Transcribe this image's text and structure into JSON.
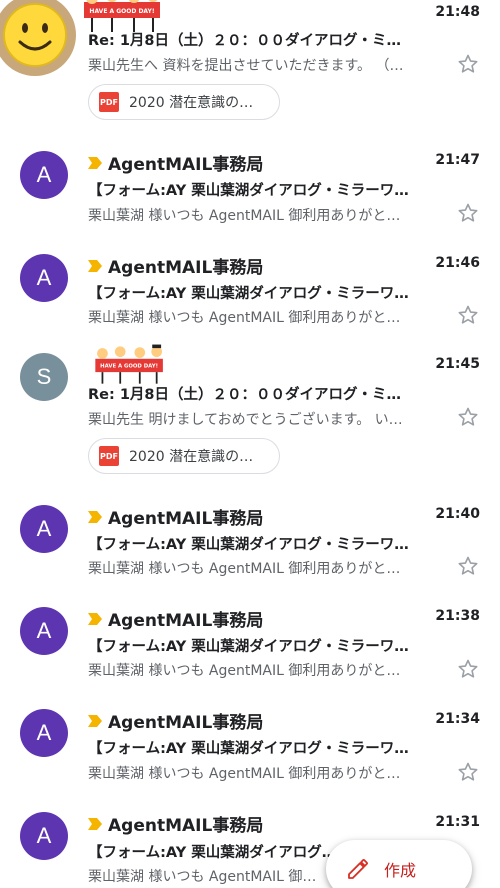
{
  "colors": {
    "accent_purple": "#5e35b1",
    "accent_gray": "#78909c",
    "important_yellow": "#f4b400",
    "compose_red": "#d93025"
  },
  "emails": [
    {
      "avatar_type": "smiley",
      "sender": "",
      "has_sticker": true,
      "sticker_text": "HAVE A GOOD DAY!",
      "time": "21:48",
      "subject": "Re: 1月8日（土）２０：００ダイアログ・ミ…",
      "snippet": "栗山先生へ 資料を提出させていただきます。 （…",
      "attachment": "2020 潜在意識の…"
    },
    {
      "avatar_type": "letter",
      "avatar_letter": "A",
      "important": true,
      "sender": "AgentMAIL事務局",
      "time": "21:47",
      "subject": "【フォーム:AY 栗山葉湖ダイアログ・ミラーワ…",
      "snippet": "栗山葉湖 様いつも AgentMAIL 御利用ありがと…"
    },
    {
      "avatar_type": "letter",
      "avatar_letter": "A",
      "important": true,
      "sender": "AgentMAIL事務局",
      "time": "21:46",
      "subject": "【フォーム:AY 栗山葉湖ダイアログ・ミラーワ…",
      "snippet": "栗山葉湖 様いつも AgentMAIL 御利用ありがと…"
    },
    {
      "avatar_type": "letter",
      "avatar_letter": "S",
      "sender": "",
      "has_sticker": true,
      "sticker_text": "HAVE A GOOD DAY!",
      "time": "21:45",
      "subject": "Re: 1月8日（土）２０：００ダイアログ・ミ…",
      "snippet": "栗山先生 明けましておめでとうございます。 い…",
      "attachment": "2020 潜在意識の…"
    },
    {
      "avatar_type": "letter",
      "avatar_letter": "A",
      "important": true,
      "sender": "AgentMAIL事務局",
      "time": "21:40",
      "subject": "【フォーム:AY 栗山葉湖ダイアログ・ミラーワ…",
      "snippet": "栗山葉湖 様いつも AgentMAIL 御利用ありがと…"
    },
    {
      "avatar_type": "letter",
      "avatar_letter": "A",
      "important": true,
      "sender": "AgentMAIL事務局",
      "time": "21:38",
      "subject": "【フォーム:AY 栗山葉湖ダイアログ・ミラーワ…",
      "snippet": "栗山葉湖 様いつも AgentMAIL 御利用ありがと…"
    },
    {
      "avatar_type": "letter",
      "avatar_letter": "A",
      "important": true,
      "sender": "AgentMAIL事務局",
      "time": "21:34",
      "subject": "【フォーム:AY 栗山葉湖ダイアログ・ミラーワ…",
      "snippet": "栗山葉湖 様いつも AgentMAIL 御利用ありがと…"
    },
    {
      "avatar_type": "letter",
      "avatar_letter": "A",
      "important": true,
      "sender": "AgentMAIL事務局",
      "time": "21:31",
      "subject": "【フォーム:AY 栗山葉湖ダイアログ・ミ…",
      "snippet": "栗山葉湖 様いつも AgentMAIL 御…"
    }
  ],
  "compose": {
    "label": "作成",
    "icon": "pencil-icon"
  }
}
